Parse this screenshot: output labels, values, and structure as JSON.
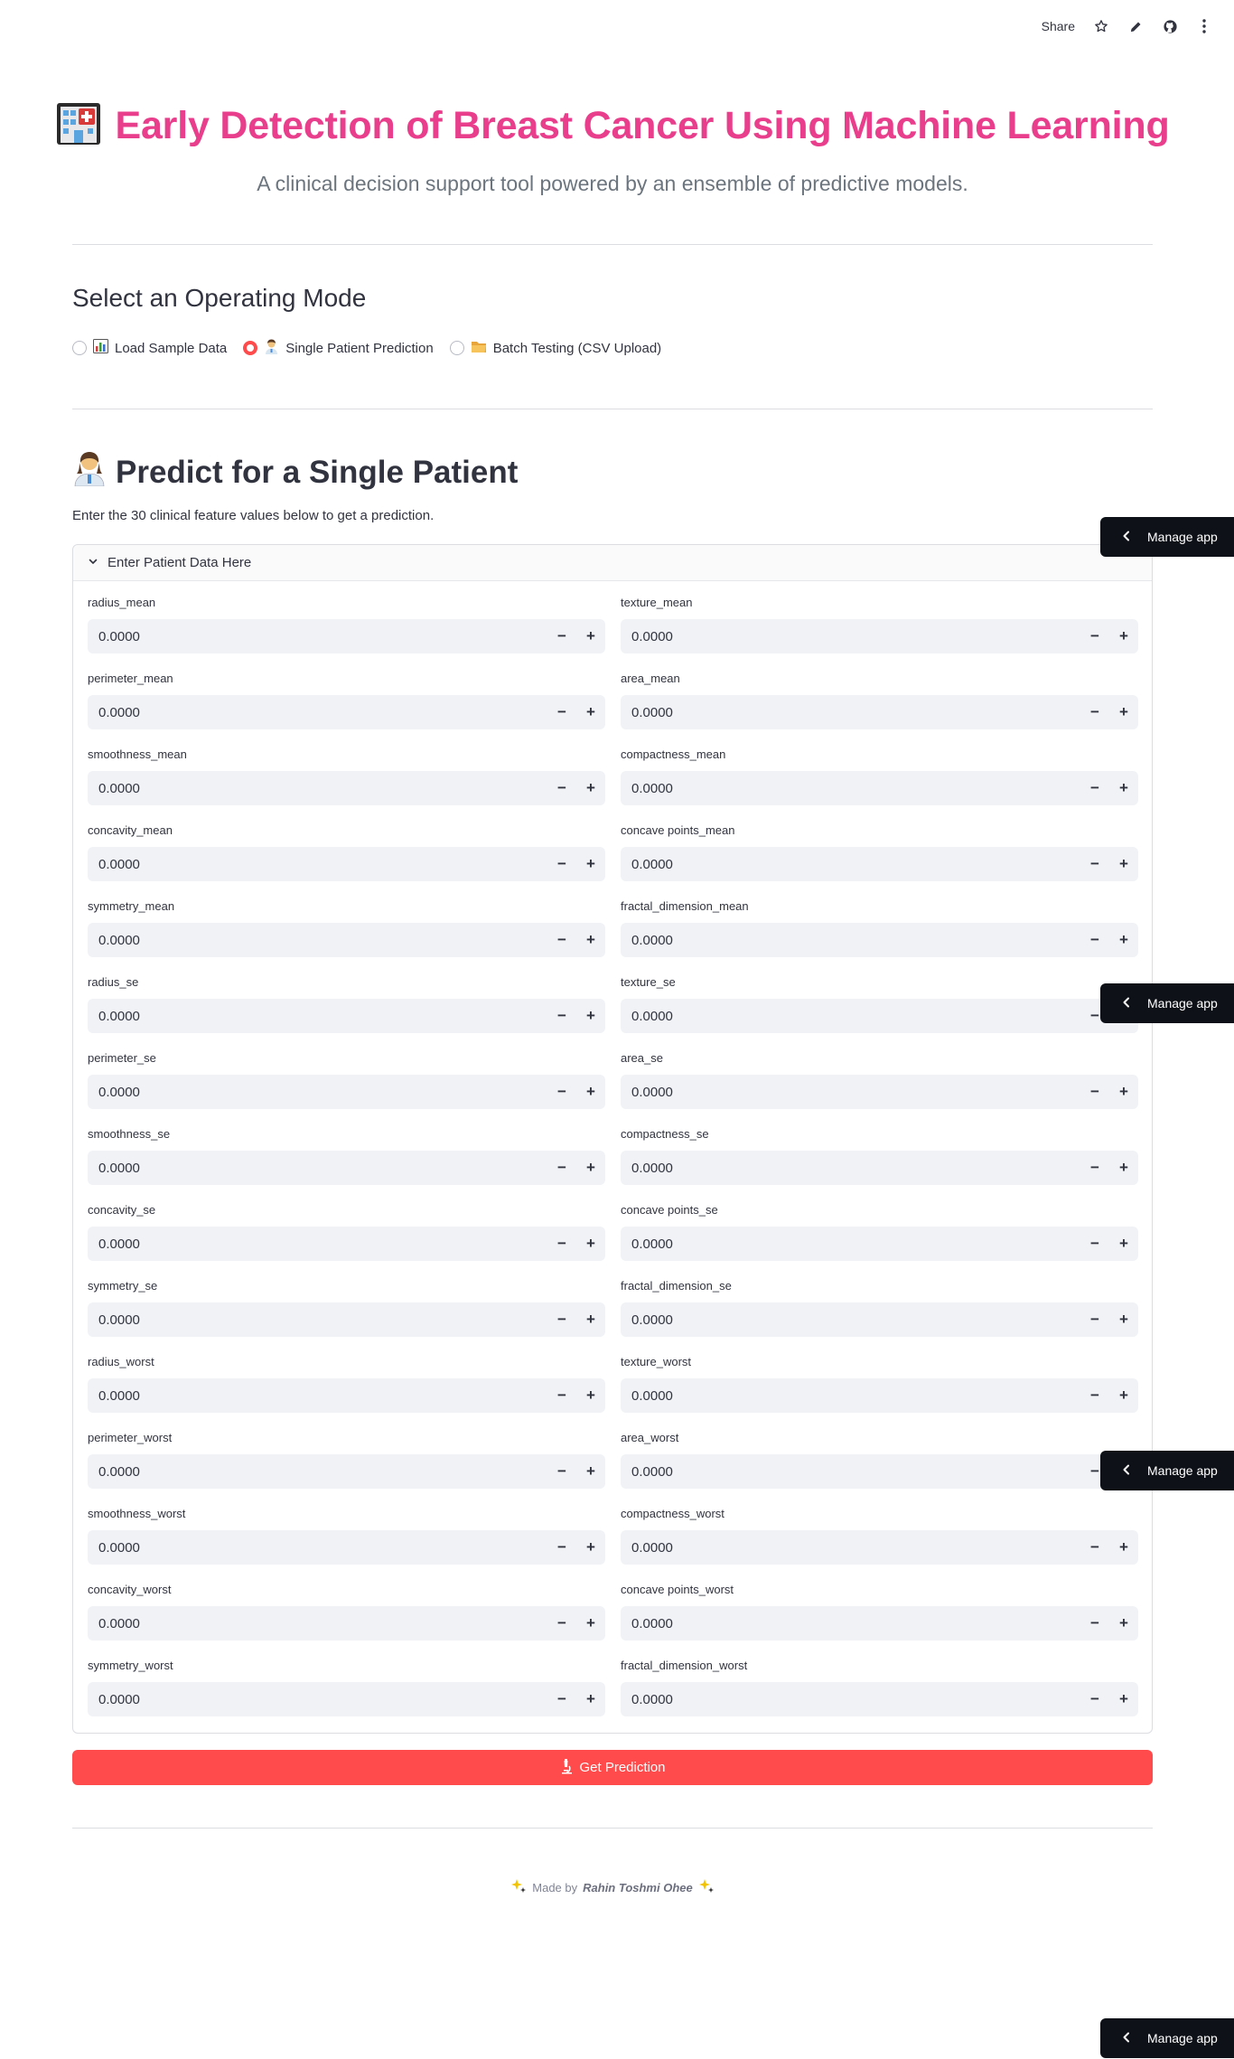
{
  "toolbar": {
    "share_label": "Share",
    "icons": [
      "star-icon",
      "pencil-icon",
      "github-icon",
      "more-vertical-icon"
    ]
  },
  "header": {
    "emoji_icon": "hospital-icon",
    "title": "Early Detection of Breast Cancer Using Machine Learning",
    "subtitle": "A clinical decision support tool powered by an ensemble of predictive models.",
    "title_color": "#e83e8c"
  },
  "mode": {
    "heading": "Select an Operating Mode",
    "selected_index": 1,
    "options": [
      {
        "icon": "bar-chart-icon",
        "label": "Load Sample Data"
      },
      {
        "icon": "health-worker-icon",
        "label": "Single Patient Prediction"
      },
      {
        "icon": "folder-icon",
        "label": "Batch Testing (CSV Upload)"
      }
    ]
  },
  "single": {
    "heading": "Predict for a Single Patient",
    "description": "Enter the 30 clinical feature values below to get a prediction.",
    "expander_label": "Enter Patient Data Here",
    "fields": [
      {
        "label": "radius_mean",
        "value": "0.0000"
      },
      {
        "label": "texture_mean",
        "value": "0.0000"
      },
      {
        "label": "perimeter_mean",
        "value": "0.0000"
      },
      {
        "label": "area_mean",
        "value": "0.0000"
      },
      {
        "label": "smoothness_mean",
        "value": "0.0000"
      },
      {
        "label": "compactness_mean",
        "value": "0.0000"
      },
      {
        "label": "concavity_mean",
        "value": "0.0000"
      },
      {
        "label": "concave points_mean",
        "value": "0.0000"
      },
      {
        "label": "symmetry_mean",
        "value": "0.0000"
      },
      {
        "label": "fractal_dimension_mean",
        "value": "0.0000"
      },
      {
        "label": "radius_se",
        "value": "0.0000"
      },
      {
        "label": "texture_se",
        "value": "0.0000"
      },
      {
        "label": "perimeter_se",
        "value": "0.0000"
      },
      {
        "label": "area_se",
        "value": "0.0000"
      },
      {
        "label": "smoothness_se",
        "value": "0.0000"
      },
      {
        "label": "compactness_se",
        "value": "0.0000"
      },
      {
        "label": "concavity_se",
        "value": "0.0000"
      },
      {
        "label": "concave points_se",
        "value": "0.0000"
      },
      {
        "label": "symmetry_se",
        "value": "0.0000"
      },
      {
        "label": "fractal_dimension_se",
        "value": "0.0000"
      },
      {
        "label": "radius_worst",
        "value": "0.0000"
      },
      {
        "label": "texture_worst",
        "value": "0.0000"
      },
      {
        "label": "perimeter_worst",
        "value": "0.0000"
      },
      {
        "label": "area_worst",
        "value": "0.0000"
      },
      {
        "label": "smoothness_worst",
        "value": "0.0000"
      },
      {
        "label": "compactness_worst",
        "value": "0.0000"
      },
      {
        "label": "concavity_worst",
        "value": "0.0000"
      },
      {
        "label": "concave points_worst",
        "value": "0.0000"
      },
      {
        "label": "symmetry_worst",
        "value": "0.0000"
      },
      {
        "label": "fractal_dimension_worst",
        "value": "0.0000"
      }
    ],
    "stepper_minus": "−",
    "stepper_plus": "+",
    "button_label": "Get Prediction",
    "button_icon": "microscope-icon",
    "button_color": "#ff4b4b"
  },
  "footer": {
    "made_by": "Made by",
    "author": "Rahin Toshmi Ohee",
    "icon": "sparkles-icon"
  },
  "manage_app": {
    "label": "Manage app"
  }
}
